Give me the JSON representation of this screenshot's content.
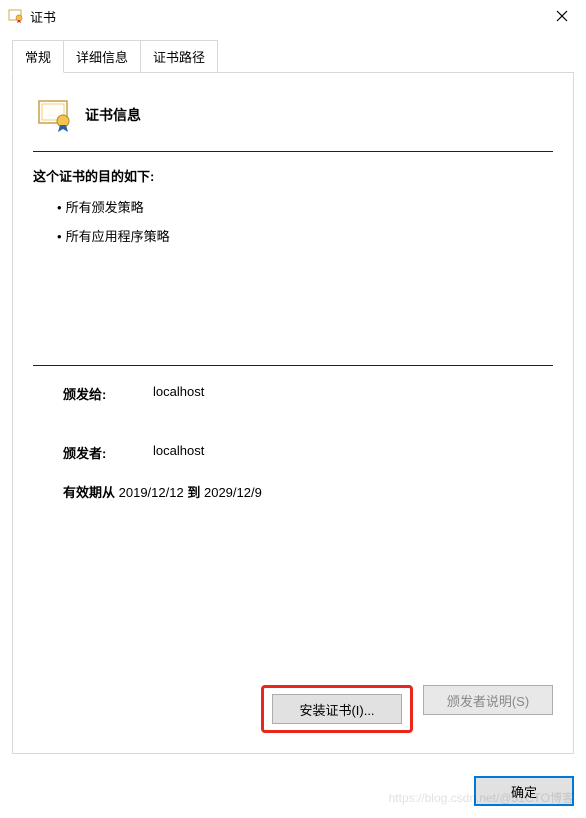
{
  "window": {
    "title": "证书"
  },
  "tabs": {
    "general": "常规",
    "details": "详细信息",
    "certpath": "证书路径"
  },
  "cert": {
    "info_title": "证书信息",
    "purposes_heading": "这个证书的目的如下:",
    "purposes": [
      "所有颁发策略",
      "所有应用程序策略"
    ],
    "issued_to_label": "颁发给:",
    "issued_to_value": "localhost",
    "issued_by_label": "颁发者:",
    "issued_by_value": "localhost",
    "validity_label_from": "有效期从",
    "validity_from": "2019/12/12",
    "validity_label_to": "到",
    "validity_to": "2029/12/9"
  },
  "buttons": {
    "install": "安装证书(I)...",
    "issuer_statement": "颁发者说明(S)",
    "ok": "确定"
  },
  "watermark": "https://blog.csdn.net/@51CTO博客"
}
